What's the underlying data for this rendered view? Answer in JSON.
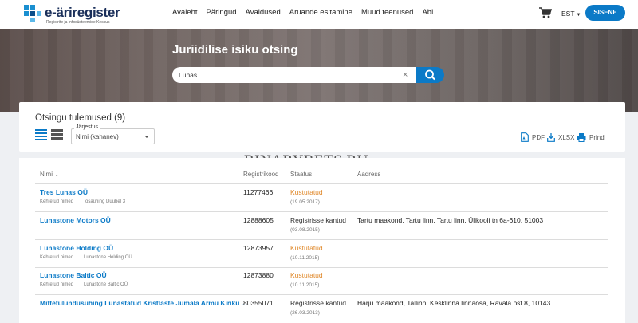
{
  "header": {
    "logo_title": "e-äriregister",
    "logo_subtitle": "Registrite ja Infosüsteemide Keskus",
    "nav": [
      "Avaleht",
      "Päringud",
      "Avaldused",
      "Aruande esitamine",
      "Muud teenused",
      "Abi"
    ],
    "lang": "EST",
    "signin_label": "SISENE"
  },
  "hero": {
    "title": "Juriidilise isiku otsing",
    "search_value": "Lunas",
    "clear_symbol": "×"
  },
  "results": {
    "title": "Otsingu tulemused (9)",
    "sort_label": "Järjestus",
    "sort_value": "Nimi (kahanev)",
    "export": {
      "pdf": "PDF",
      "xlsx": "XLSX",
      "print": "Prindi"
    }
  },
  "watermark": "BINARYBETS.RU",
  "table": {
    "columns": {
      "name": "Nimi",
      "code": "Registrikood",
      "status": "Staatus",
      "address": "Aadress"
    },
    "rows": [
      {
        "name": "Tres Lunas OÜ",
        "sub_label": "Kehtetud nimed",
        "sub_value": "osaühing Duubel 3",
        "code": "11277466",
        "status": "Kustutatud",
        "status_type": "deleted",
        "date": "(19.05.2017)",
        "address": ""
      },
      {
        "name": "Lunastone Motors OÜ",
        "sub_label": "",
        "sub_value": "",
        "code": "12888605",
        "status": "Registrisse kantud",
        "status_type": "registered",
        "date": "(03.08.2015)",
        "address": "Tartu maakond, Tartu linn, Tartu linn, Ülikooli tn 6a-610, 51003"
      },
      {
        "name": "Lunastone Holding OÜ",
        "sub_label": "Kehtetud nimed",
        "sub_value": "Lunastone Holding OÜ",
        "code": "12873957",
        "status": "Kustutatud",
        "status_type": "deleted",
        "date": "(10.11.2015)",
        "address": ""
      },
      {
        "name": "Lunastone Baltic OÜ",
        "sub_label": "Kehtetud nimed",
        "sub_value": "Lunastone Baltic OÜ",
        "code": "12873880",
        "status": "Kustutatud",
        "status_type": "deleted",
        "date": "(10.11.2015)",
        "address": ""
      },
      {
        "name": "Mittetulundusühing Lunastatud Kristlaste Jumala Armu Kiriku ...",
        "sub_label": "",
        "sub_value": "",
        "code": "80355071",
        "status": "Registrisse kantud",
        "status_type": "registered",
        "date": "(26.03.2013)",
        "address": "Harju maakond, Tallinn, Kesklinna linnaosa, Rävala pst 8, 10143"
      }
    ]
  },
  "colors": {
    "accent": "#0b7ac7",
    "deleted": "#e0892b",
    "registered": "#333333"
  }
}
